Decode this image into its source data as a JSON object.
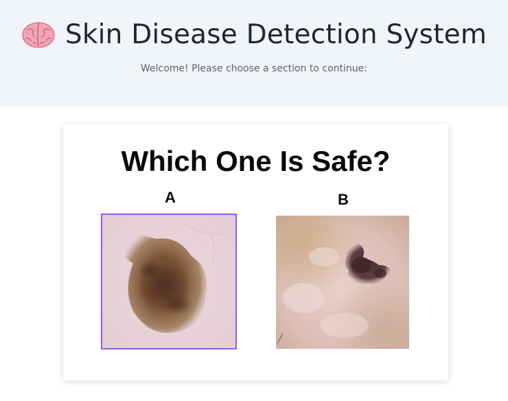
{
  "header": {
    "title": "Skin Disease Detection System",
    "subtitle": "Welcome! Please choose a section to continue:",
    "icon": "brain-icon"
  },
  "quiz": {
    "question": "Which One Is Safe?",
    "options": [
      {
        "label": "A",
        "selected": true
      },
      {
        "label": "B",
        "selected": false
      }
    ]
  },
  "colors": {
    "header_bg": "#f1f4f8",
    "title_text": "#1f2633",
    "subtitle_text": "#5b6270",
    "selection_outline": "#8b5cf6",
    "brain_pink": "#f3a3b5"
  }
}
